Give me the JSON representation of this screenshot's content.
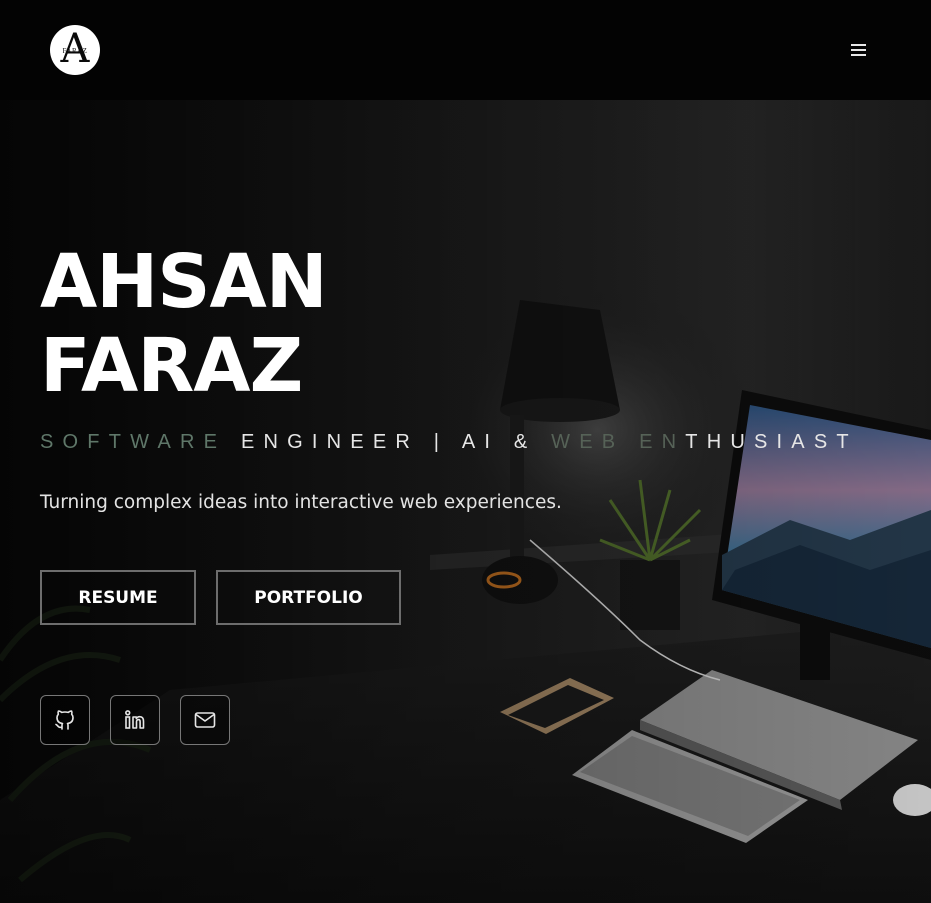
{
  "header": {
    "logo_letter": "A",
    "logo_word": "FARAZ",
    "menu_icon": "hamburger-icon"
  },
  "hero": {
    "name_line1": "AHSAN",
    "name_line2": "FARAZ",
    "tagline_part1": "SOFTWARE ",
    "tagline_part2": "ENGINEER | AI & ",
    "tagline_part3": "WEB EN",
    "tagline_part4": "THUSIAST",
    "subtitle": "Turning complex ideas into interactive web experiences.",
    "buttons": {
      "resume": "RESUME",
      "portfolio": "PORTFOLIO"
    },
    "social": [
      {
        "icon": "github-icon"
      },
      {
        "icon": "linkedin-icon"
      },
      {
        "icon": "mail-icon"
      }
    ]
  },
  "colors": {
    "background": "#000000",
    "header": "#030303",
    "accent_text": "#5f7769",
    "button_border": "#6d6d6d"
  }
}
